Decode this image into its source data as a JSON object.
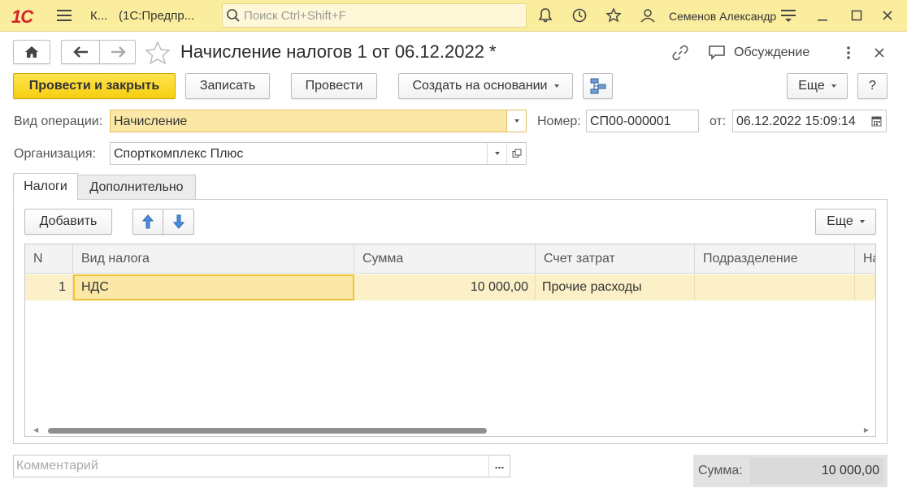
{
  "topbar": {
    "logo": "1С",
    "app_short": "К...",
    "app_title": "(1С:Предпр...",
    "search_placeholder": "Поиск Ctrl+Shift+F",
    "user": "Семенов Александр"
  },
  "header": {
    "title": "Начисление налогов 1 от 06.12.2022 *",
    "discussion": "Обсуждение"
  },
  "commands": {
    "post_close": "Провести и закрыть",
    "save": "Записать",
    "post": "Провести",
    "create_based": "Создать на основании",
    "more": "Еще",
    "help": "?"
  },
  "form": {
    "operation_label": "Вид операции:",
    "operation_value": "Начисление",
    "number_label": "Номер:",
    "number_value": "СП00-000001",
    "date_label": "от:",
    "date_value": "06.12.2022 15:09:14",
    "org_label": "Организация:",
    "org_value": "Спорткомплекс Плюс"
  },
  "tabs": [
    {
      "label": "Налоги",
      "active": true
    },
    {
      "label": "Дополнительно",
      "active": false
    }
  ],
  "table_toolbar": {
    "add": "Добавить",
    "more": "Еще"
  },
  "table": {
    "columns": [
      "N",
      "Вид налога",
      "Сумма",
      "Счет затрат",
      "Подразделение",
      "На"
    ],
    "rows": [
      {
        "n": "1",
        "tax": "НДС",
        "sum": "10 000,00",
        "account": "Прочие расходы",
        "dept": ""
      }
    ]
  },
  "footer": {
    "comment_placeholder": "Комментарий",
    "comment_more": "...",
    "sum_label": "Сумма:",
    "sum_value": "10 000,00"
  }
}
